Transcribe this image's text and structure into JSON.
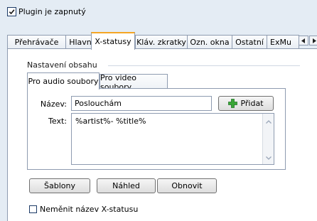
{
  "plugin_enabled": {
    "label": "Plugin je zapnutý",
    "checked": true
  },
  "tabs": [
    {
      "label": "Přehrávače"
    },
    {
      "label": "Hlavní"
    },
    {
      "label": "X-statusy",
      "active": true
    },
    {
      "label": "Kláv. zkratky"
    },
    {
      "label": "Ozn. okna"
    },
    {
      "label": "Ostatní"
    },
    {
      "label": "ExMu"
    }
  ],
  "content_settings": {
    "title": "Nastavení obsahu"
  },
  "subtabs": [
    {
      "label": "Pro audio soubory",
      "active": true
    },
    {
      "label": "Pro video soubory"
    }
  ],
  "form": {
    "name_label": "Název:",
    "name_value": "Poslouchám",
    "add_label": "Přidat",
    "text_label": "Text:",
    "text_value": "%artist%- %title%"
  },
  "buttons": {
    "templates": "Šablony",
    "preview": "Náhled",
    "refresh": "Obnovit"
  },
  "keep_name": {
    "label": "Neměnit název X-statusu",
    "checked": false
  },
  "colors": {
    "active_tab_accent": "#f5a623",
    "add_icon": "#3aa637"
  }
}
